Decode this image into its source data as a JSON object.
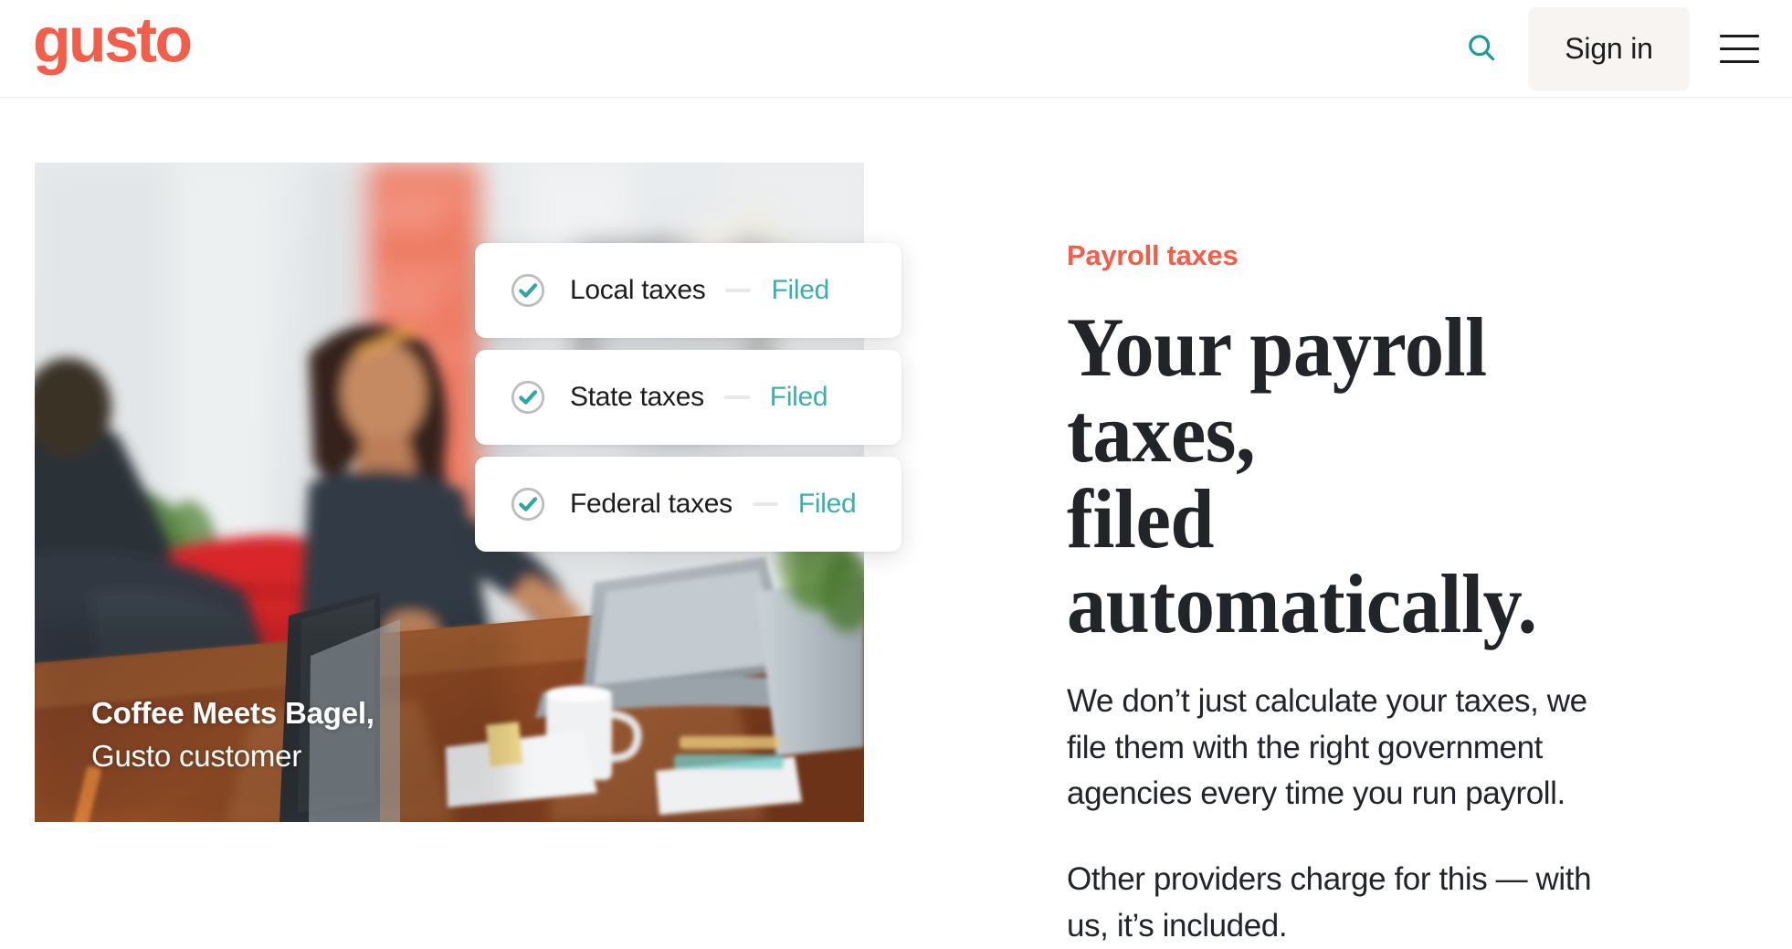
{
  "header": {
    "logo_text": "gusto",
    "search_label": "Search",
    "signin_label": "Sign in",
    "menu_label": "Menu",
    "icons": {
      "search": "search-icon",
      "menu": "hamburger-menu-icon"
    }
  },
  "media": {
    "caption_line1": "Coffee Meets Bagel,",
    "caption_line2": "Gusto customer",
    "alt": "Woman working on a laptop at a conference table in an office"
  },
  "status_cards": [
    {
      "label": "Local taxes",
      "separator": "—",
      "status": "Filed",
      "icon": "check-circle-icon"
    },
    {
      "label": "State taxes",
      "separator": "—",
      "status": "Filed",
      "icon": "check-circle-icon"
    },
    {
      "label": "Federal taxes",
      "separator": "—",
      "status": "Filed",
      "icon": "check-circle-icon"
    }
  ],
  "content": {
    "eyebrow": "Payroll taxes",
    "headline_line1": "Your payroll taxes,",
    "headline_line2": "filed automatically.",
    "paragraph1": "We don’t just calculate your taxes, we file them with the right government agencies every time you run payroll.",
    "paragraph2": "Other providers charge for this — with us, it’s included."
  },
  "colors": {
    "brand_coral": "#f45d48",
    "teal": "#3aafae",
    "search_teal": "#1a9a9a",
    "text_dark": "#21252a",
    "signin_bg": "#f8f4f1",
    "divider": "#ededed"
  }
}
